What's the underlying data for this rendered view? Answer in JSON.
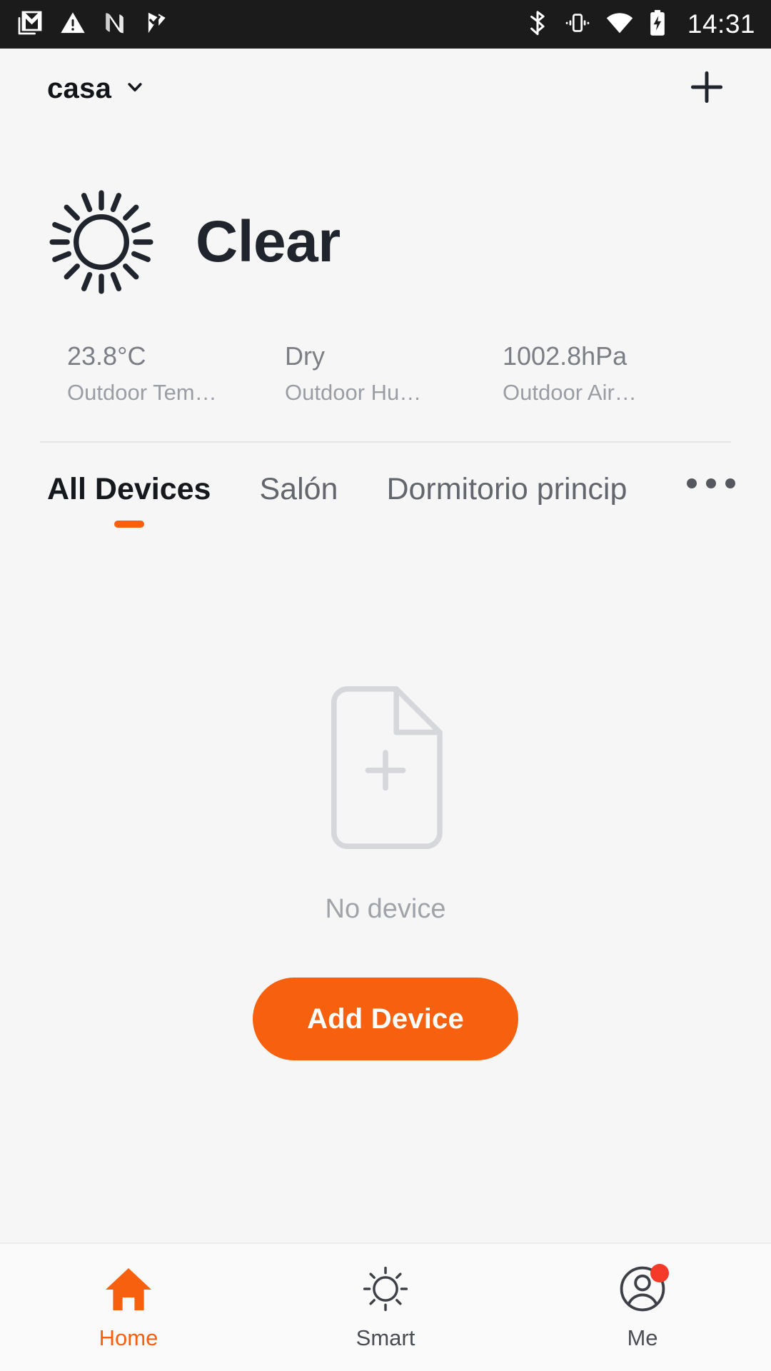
{
  "colors": {
    "accent": "#f6600f",
    "background": "#f6f6f6",
    "statusbar_bg": "#1b1b1b",
    "badge_red": "#f53a2a",
    "muted_text": "#9a9ea4"
  },
  "statusbar": {
    "left_icons": [
      "gmail-icon",
      "warning-triangle-icon",
      "nubank-n-icon",
      "checkmark-flag-icon"
    ],
    "right_icons": [
      "bluetooth-icon",
      "vibrate-icon",
      "wifi-icon",
      "battery-charging-icon"
    ],
    "time": "14:31"
  },
  "header": {
    "home_name": "casa",
    "chevron": "chevron-down-icon",
    "add_label": "+"
  },
  "weather": {
    "icon": "sun-clear-icon",
    "condition": "Clear",
    "metrics": [
      {
        "value": "23.8°C",
        "label": "Outdoor Tem…"
      },
      {
        "value": "Dry",
        "label": "Outdoor Hu…"
      },
      {
        "value": "1002.8hPa",
        "label": "Outdoor Air…"
      }
    ]
  },
  "tabs": {
    "items": [
      {
        "label": "All Devices",
        "active": true
      },
      {
        "label": "Salón",
        "active": false
      },
      {
        "label": "Dormitorio princip",
        "active": false
      }
    ],
    "more_label": "•••"
  },
  "empty_state": {
    "icon": "file-plus-icon",
    "text": "No device",
    "button_label": "Add Device"
  },
  "bottomnav": {
    "items": [
      {
        "label": "Home",
        "icon": "home-icon",
        "active": true,
        "badge": false
      },
      {
        "label": "Smart",
        "icon": "sun-icon",
        "active": false,
        "badge": false
      },
      {
        "label": "Me",
        "icon": "account-circle-icon",
        "active": false,
        "badge": true
      }
    ]
  }
}
